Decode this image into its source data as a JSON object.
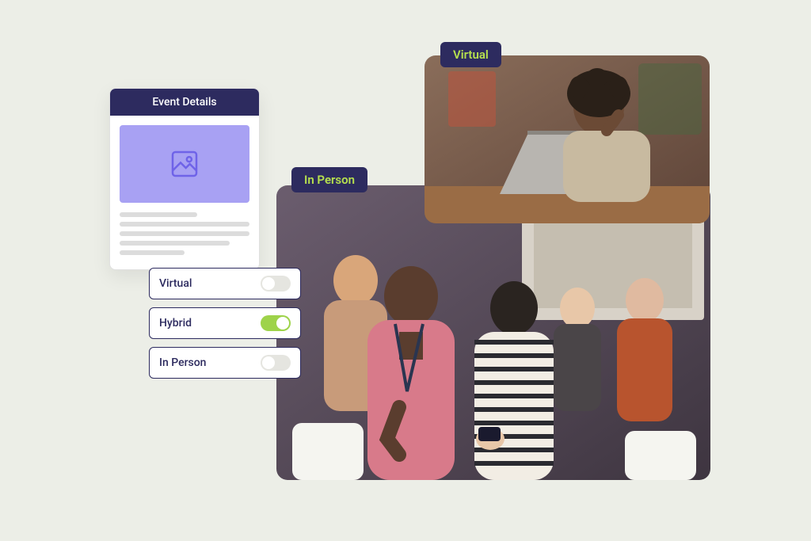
{
  "eventCard": {
    "title": "Event Details"
  },
  "options": [
    {
      "label": "Virtual",
      "on": false
    },
    {
      "label": "Hybrid",
      "on": true
    },
    {
      "label": "In Person",
      "on": false
    }
  ],
  "tags": {
    "inPerson": "In Person",
    "virtual": "Virtual"
  },
  "colors": {
    "navy": "#2d2b5f",
    "lime": "#b6e04e",
    "lavender": "#a8a1f3",
    "bg": "#eceee7"
  }
}
